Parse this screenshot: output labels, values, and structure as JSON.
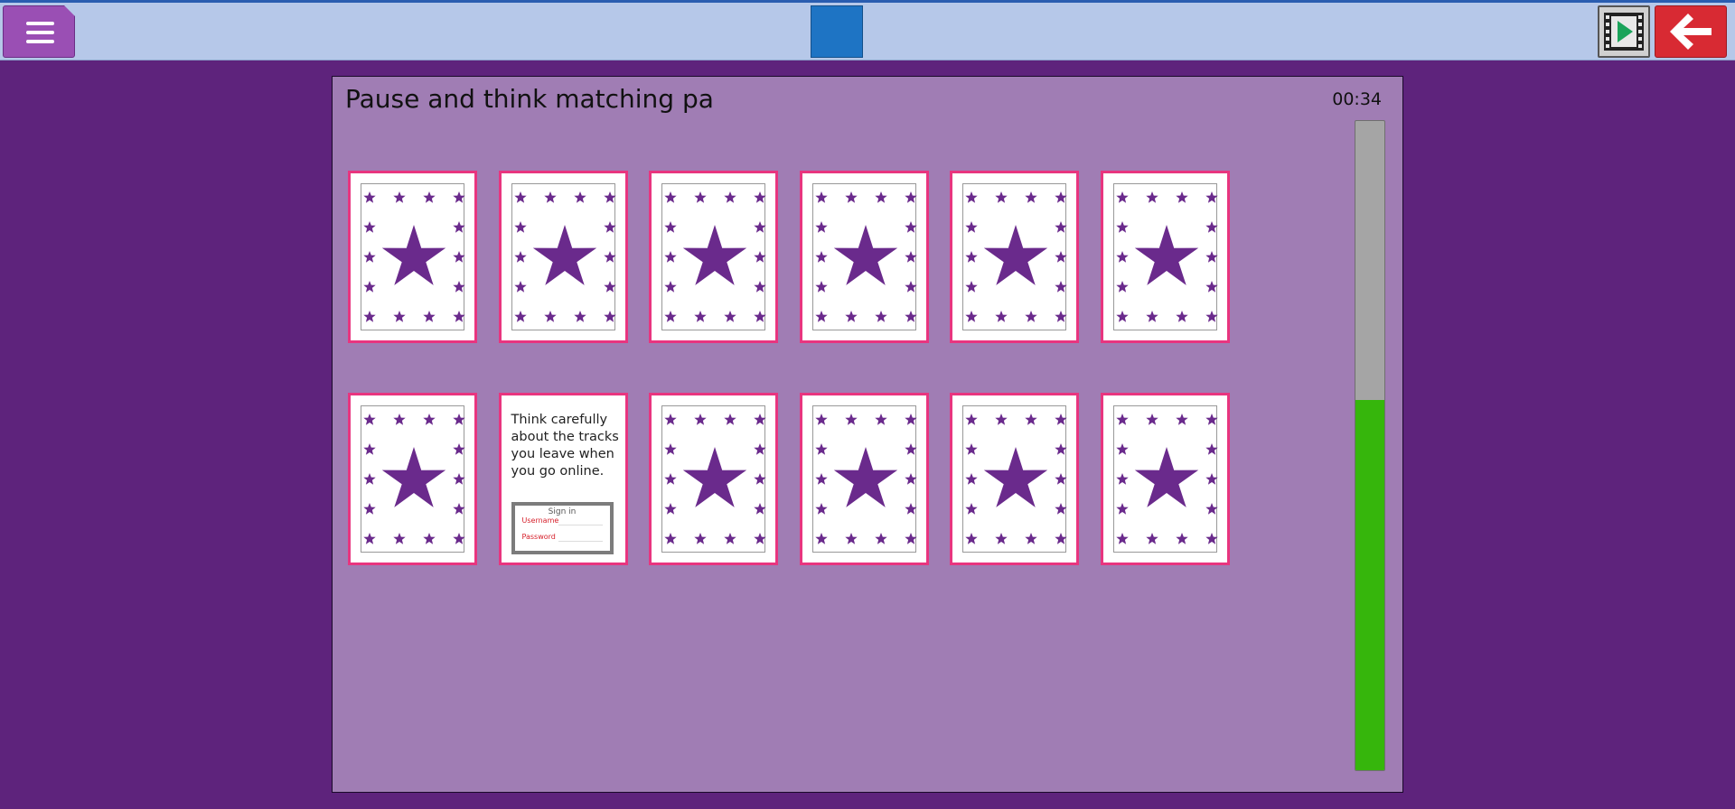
{
  "toolbar": {
    "menu_icon": "hamburger-menu-icon",
    "video_icon": "film-play-icon",
    "back_icon": "arrow-left-icon",
    "colors": {
      "bar": "#b6c8e9",
      "menu": "#9a4fb4",
      "center": "#1e74c4",
      "back": "#d82a33"
    }
  },
  "game": {
    "title": "Pause and think matching pa",
    "timer": "00:34",
    "progress_percent": 57,
    "card_back_icon": "star-pattern-icon",
    "cards": [
      {
        "state": "hidden"
      },
      {
        "state": "hidden"
      },
      {
        "state": "hidden"
      },
      {
        "state": "hidden"
      },
      {
        "state": "hidden"
      },
      {
        "state": "hidden"
      },
      {
        "state": "hidden"
      },
      {
        "state": "revealed",
        "text": "Think carefully about the tracks you leave when you go online.",
        "signin_title": "Sign in",
        "signin_username": "Username",
        "signin_password": "Password"
      },
      {
        "state": "hidden"
      },
      {
        "state": "hidden"
      },
      {
        "state": "hidden"
      },
      {
        "state": "hidden"
      }
    ]
  }
}
